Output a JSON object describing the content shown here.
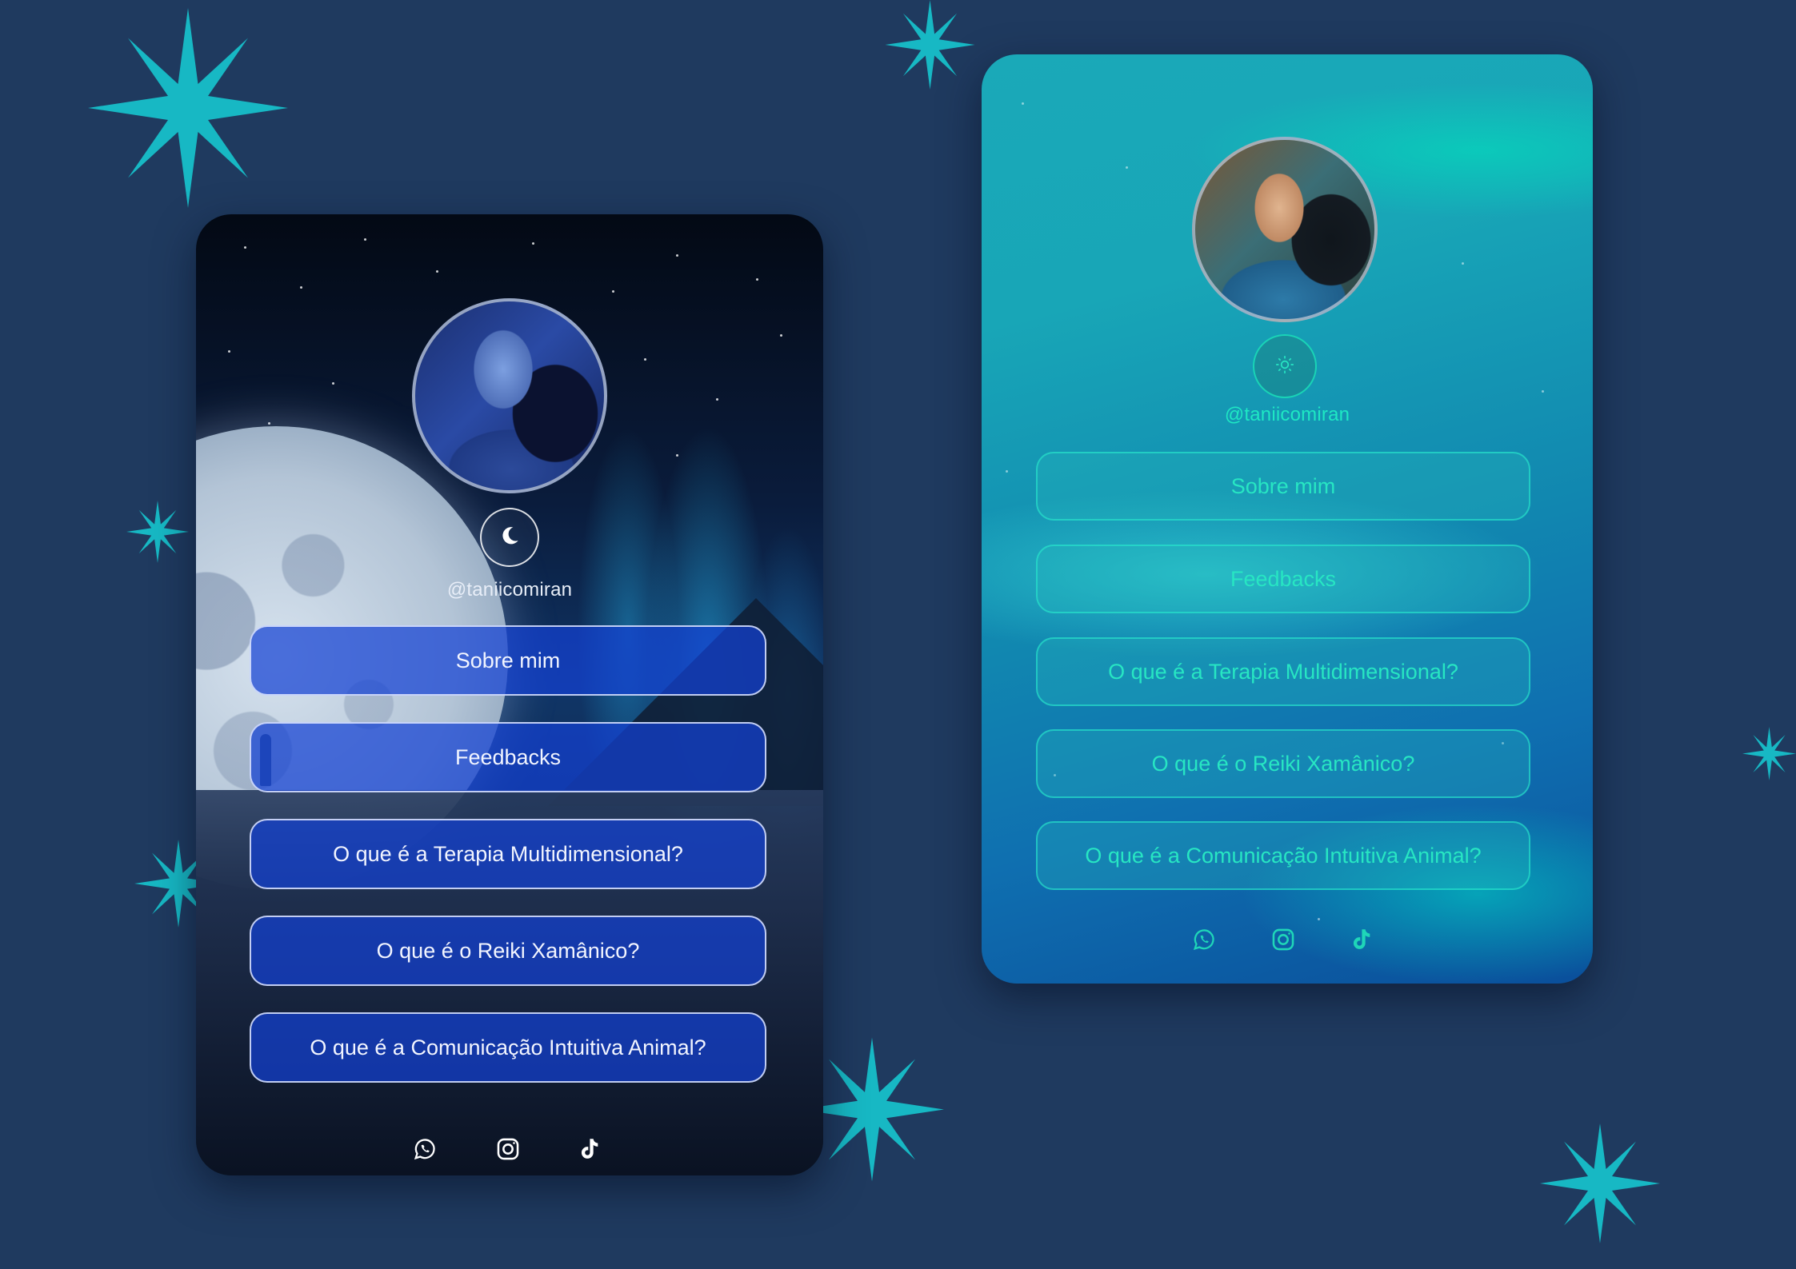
{
  "dark_card": {
    "handle": "@taniicomiran",
    "theme_toggle_icon": "moon-icon",
    "links": [
      {
        "label": "Sobre mim"
      },
      {
        "label": "Feedbacks"
      },
      {
        "label": "O que é a Terapia Multidimensional?"
      },
      {
        "label": "O que é o Reiki Xamânico?"
      },
      {
        "label": "O que é a Comunicação Intuitiva Animal?"
      }
    ],
    "social_icons": [
      "whatsapp-icon",
      "instagram-icon",
      "tiktok-icon"
    ],
    "accent_color": "#1441d2",
    "text_color": "#f2f5ff"
  },
  "light_card": {
    "handle": "@taniicomiran",
    "theme_toggle_icon": "sun-icon",
    "links": [
      {
        "label": "Sobre mim"
      },
      {
        "label": "Feedbacks"
      },
      {
        "label": "O que é a Terapia Multidimensional?"
      },
      {
        "label": "O que é o Reiki Xamânico?"
      },
      {
        "label": "O que é a Comunicação Intuitiva Animal?"
      }
    ],
    "social_icons": [
      "whatsapp-icon",
      "instagram-icon",
      "tiktok-icon"
    ],
    "accent_color": "#27e6c3"
  },
  "background": {
    "color": "#1f3a5f",
    "star_color": "#17b8c4",
    "decoration_icon": "sparkle-star-icon"
  }
}
